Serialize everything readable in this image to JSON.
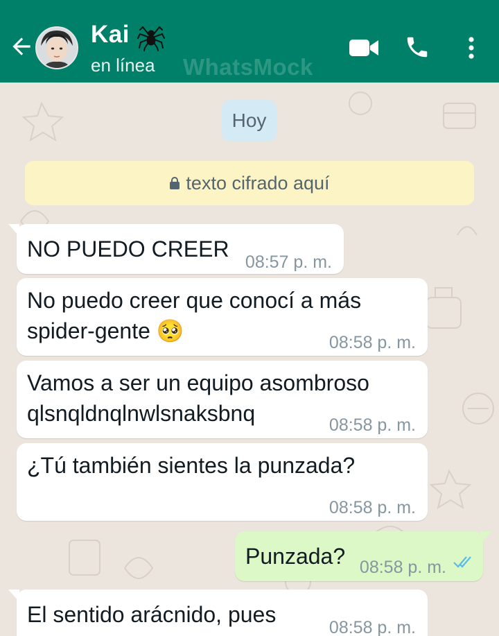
{
  "header": {
    "contact_name": "Kai",
    "status": "en línea",
    "watermark": "WhatsMock",
    "colors": {
      "bar": "#008069",
      "text": "#ffffff"
    },
    "icons": [
      "back-arrow-icon",
      "spider-icon",
      "video-camera-icon",
      "phone-icon",
      "more-vert-icon"
    ]
  },
  "chat": {
    "date_label": "Hoy",
    "encryption_notice": "texto cifrado aquí",
    "messages": [
      {
        "direction": "in",
        "lines": [
          "NO PUEDO CREER"
        ],
        "time": "08:57 p. m."
      },
      {
        "direction": "in",
        "lines": [
          "No puedo creer que conocí a más",
          "spider-gente 🥺"
        ],
        "time": "08:58 p. m."
      },
      {
        "direction": "in",
        "lines": [
          "Vamos a ser un equipo asombroso",
          "qlsnqldnqlnwlsnaksbnq"
        ],
        "time": "08:58 p. m."
      },
      {
        "direction": "in",
        "lines": [
          "¿Tú también sientes la punzada?"
        ],
        "time": "08:58 p. m."
      },
      {
        "direction": "out",
        "lines": [
          "Punzada?"
        ],
        "time": "08:58 p. m.",
        "status": "read-double-check"
      },
      {
        "direction": "in",
        "lines": [
          "El sentido arácnido, pues"
        ],
        "time": "08:58 p. m."
      }
    ],
    "colors": {
      "incoming": "#ffffff",
      "outgoing": "#dcf8c6",
      "time": "#8696a0",
      "read_ticks": "#53bdeb"
    }
  }
}
